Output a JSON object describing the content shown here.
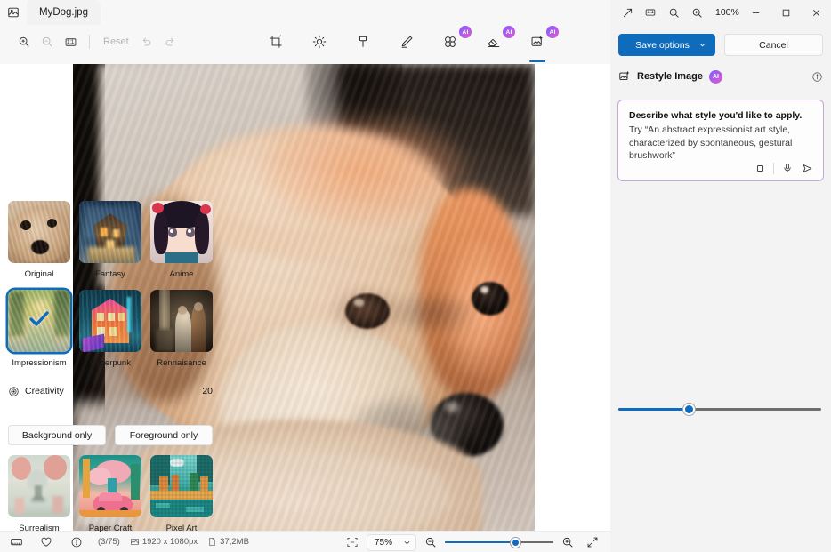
{
  "window": {
    "app_icon": "photo-app-icon",
    "tab_label": "MyDog.jpg",
    "minimize": "−",
    "maximize": "□",
    "close": "×"
  },
  "editor_toolbar": {
    "zoom_in": "zoom-in-icon",
    "zoom_out": "zoom-out-icon",
    "actual_size": "1:1",
    "reset_label": "Reset",
    "undo": "undo-icon",
    "redo": "redo-icon",
    "tools": [
      {
        "name": "crop-tool",
        "label": "Crop",
        "ai": false,
        "active": false
      },
      {
        "name": "adjustment-tool",
        "label": "Adjustment",
        "ai": false,
        "active": false
      },
      {
        "name": "markup-tool",
        "label": "Markup",
        "ai": false,
        "active": false
      },
      {
        "name": "retouch-tool",
        "label": "Retouch",
        "ai": false,
        "active": false
      },
      {
        "name": "blur-background-tool",
        "label": "Blur background",
        "ai": true,
        "ai_badge": "AI",
        "active": false
      },
      {
        "name": "erase-objects-tool",
        "label": "Erase objects",
        "ai": true,
        "ai_badge": "AI",
        "active": false
      },
      {
        "name": "restyle-image-tool",
        "label": "Restyle image",
        "ai": true,
        "ai_badge": "AI",
        "active": true
      }
    ]
  },
  "statusbar": {
    "film_strip_icon": "filmstrip-icon",
    "favorite_icon": "heart-icon",
    "info_icon": "info-icon",
    "counter": "(3/75)",
    "dimensions_icon": "dimensions-icon",
    "dimensions": "1920 x 1080px",
    "filesize_icon": "file-icon",
    "filesize": "37,2MB",
    "fit_icon": "fit-to-window-icon",
    "zoom_value": "75%",
    "zoom_caret": "chevron-down-icon",
    "zoom_out_icon": "zoom-out-icon",
    "zoom_in_icon": "zoom-in-icon",
    "zoom_percent": 65,
    "fullscreen_icon": "expand-icon"
  },
  "panel": {
    "top": {
      "expand_icon": "expand-arrow-icon",
      "actual_size_icon": "1:1",
      "zoom_out_icon": "zoom-out-icon",
      "zoom_in_icon": "zoom-in-icon",
      "zoom_value": "100%"
    },
    "save_label": "Save options",
    "save_caret": "chevron-down-icon",
    "cancel_label": "Cancel",
    "section": {
      "icon": "restyle-image-icon",
      "title": "Restyle Image",
      "ai_badge": "AI",
      "info_icon": "info-circle-icon"
    },
    "prompt": {
      "strong": "Describe what style you'd like to apply.",
      "hint": "Try “An abstract expressionist art style, characterized by spontaneous, gestural brushwork”",
      "value": "",
      "placeholder": "Describe what style you'd like to apply.",
      "attach_icon": "square-icon",
      "mic_icon": "microphone-icon",
      "send_icon": "send-icon"
    },
    "styles_top": [
      {
        "name": "style-original",
        "label": "Original",
        "selected": false
      },
      {
        "name": "style-fantasy",
        "label": "Fantasy",
        "selected": false
      },
      {
        "name": "style-anime",
        "label": "Anime",
        "selected": false
      }
    ],
    "styles_mid": [
      {
        "name": "style-impressionism",
        "label": "Impressionism",
        "selected": true
      },
      {
        "name": "style-cyberpunk",
        "label": "Cyberpunk",
        "selected": false
      },
      {
        "name": "style-rennaisance",
        "label": "Rennaisance",
        "selected": false
      }
    ],
    "styles_bottom": [
      {
        "name": "style-surrealism",
        "label": "Surrealism",
        "selected": false
      },
      {
        "name": "style-paper-craft",
        "label": "Paper Craft",
        "selected": false
      },
      {
        "name": "style-pixel-art",
        "label": "Pixel Art",
        "selected": false
      }
    ],
    "creativity": {
      "icon": "creativity-target-icon",
      "label": "Creativity",
      "value": "20",
      "percent": 35
    },
    "background_only_label": "Background only",
    "foreground_only_label": "Foreground only"
  },
  "colors": {
    "accent": "#0f6cbd",
    "panel_bg": "#f3f3f3",
    "toolbar_bg": "#f7f7f7",
    "canvas_bg": "#ffffff",
    "ai_badge_gradient_start": "#7b5cff",
    "ai_badge_gradient_end": "#e05ad0",
    "prompt_border": "#c4a8d8",
    "close_hover": "#c42b1c"
  }
}
